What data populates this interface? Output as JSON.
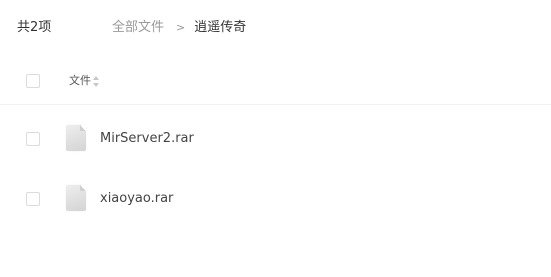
{
  "header": {
    "item_count": "共2项",
    "breadcrumb": {
      "root": "全部文件",
      "separator": ">",
      "current": "逍遥传奇"
    }
  },
  "table": {
    "columns": {
      "filename": "文件"
    },
    "rows": [
      {
        "name": "MirServer2.rar",
        "icon": "archive-file-icon"
      },
      {
        "name": "xiaoyao.rar",
        "icon": "archive-file-icon"
      }
    ]
  }
}
